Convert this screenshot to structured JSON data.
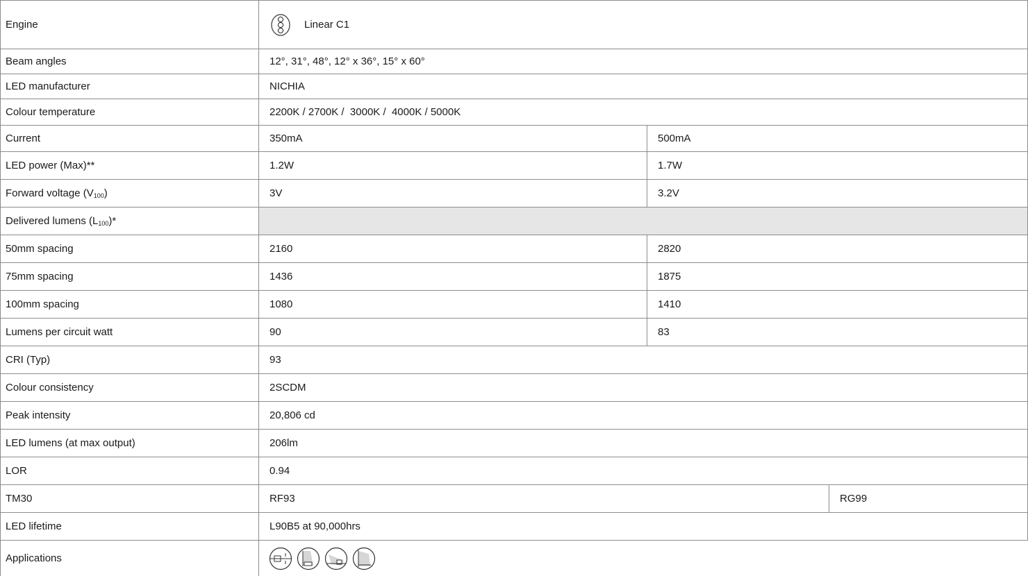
{
  "rows": [
    {
      "label": "Engine",
      "value": "Linear C1",
      "icon": "linear-c1-engine-icon"
    },
    {
      "label": "Beam angles",
      "value": "12°, 31°, 48°, 12° x 36°, 15° x 60°"
    },
    {
      "label": "LED manufacturer",
      "value": "NICHIA"
    },
    {
      "label": "Colour temperature",
      "value": "2200K / 2700K /  3000K /  4000K / 5000K"
    },
    {
      "label": "Current",
      "a": "350mA",
      "b": "500mA"
    },
    {
      "label": "LED power (Max)**",
      "a": "1.2W",
      "b": "1.7W"
    },
    {
      "label_pre": "Forward voltage (V",
      "label_sub": "100",
      "label_post": ")",
      "a": "3V",
      "b": "3.2V"
    },
    {
      "label_pre": "Delivered lumens (L",
      "label_sub": "100",
      "label_post": ")*"
    },
    {
      "label": "50mm spacing",
      "a": "2160",
      "b": "2820"
    },
    {
      "label": "75mm spacing",
      "a": "1436",
      "b": "1875"
    },
    {
      "label": "100mm spacing",
      "a": "1080",
      "b": "1410"
    },
    {
      "label": "Lumens per circuit watt",
      "a": "90",
      "b": "83"
    },
    {
      "label": "CRI (Typ)",
      "value": "93"
    },
    {
      "label": "Colour consistency",
      "value": "2SCDM"
    },
    {
      "label": "Peak intensity",
      "value": "20,806 cd"
    },
    {
      "label": "LED lumens (at max output)",
      "value": "206lm"
    },
    {
      "label": "LOR",
      "value": "0.94"
    },
    {
      "label": "TM30",
      "a": "RF93",
      "b": "RG99"
    },
    {
      "label": "LED lifetime",
      "value": "L90B5 at 90,000hrs"
    },
    {
      "label": "Applications",
      "icons": [
        "wall-washing-icon",
        "recessed-downlight-icon",
        "accent-lighting-icon",
        "grazing-icon"
      ]
    }
  ],
  "colors": {
    "border": "#8c8c8c",
    "shade": "#e6e6e6",
    "text": "#1a1a1a"
  }
}
